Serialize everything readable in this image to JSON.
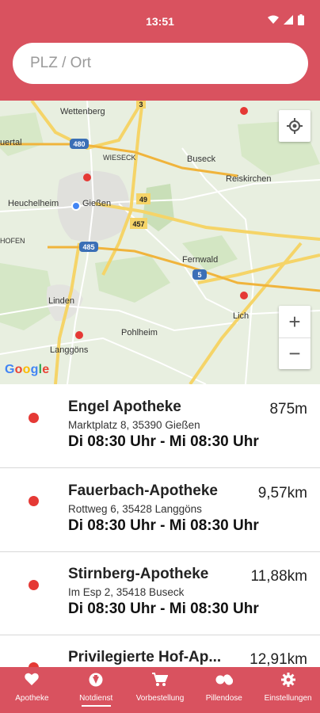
{
  "status_bar": {
    "time": "13:51",
    "icons": [
      "wifi-icon",
      "signal-icon",
      "battery-icon"
    ]
  },
  "search": {
    "placeholder": "PLZ / Ort",
    "value": ""
  },
  "map": {
    "place_labels": [
      "Wettenberg",
      "Wieseck",
      "Buseck",
      "Reiskirchen",
      "Heuchelheim",
      "Gießen",
      "Fernwald",
      "Linden",
      "Lich",
      "Pohlheim",
      "Langgöns",
      "uertal",
      "HOFEN"
    ],
    "road_numbers": [
      "3",
      "480",
      "49",
      "457",
      "485",
      "5"
    ],
    "google_logo": "Google",
    "zoom_in_label": "+",
    "zoom_out_label": "−",
    "marker_color": "#e53935",
    "location_dot_color": "#4285f4"
  },
  "pharmacies": [
    {
      "name": "Engel Apotheke",
      "address": "Marktplatz 8, 35390 Gießen",
      "hours": "Di 08:30 Uhr - Mi 08:30 Uhr",
      "distance": "875m"
    },
    {
      "name": "Fauerbach-Apotheke",
      "address": "Rottweg 6, 35428 Langgöns",
      "hours": "Di 08:30 Uhr - Mi 08:30 Uhr",
      "distance": "9,57km"
    },
    {
      "name": "Stirnberg-Apotheke",
      "address": "Im Esp 2, 35418 Buseck",
      "hours": "Di 08:30 Uhr - Mi 08:30 Uhr",
      "distance": "11,88km"
    },
    {
      "name": "Privilegierte Hof-Ap...",
      "distance": "12,91km"
    }
  ],
  "bottom_nav": [
    {
      "label": "Apotheke",
      "icon": "heart-icon",
      "active": false
    },
    {
      "label": "Notdienst",
      "icon": "emergency-icon",
      "active": true
    },
    {
      "label": "Vorbestellung",
      "icon": "cart-icon",
      "active": false
    },
    {
      "label": "Pillendose",
      "icon": "pill-icon",
      "active": false
    },
    {
      "label": "Einstellungen",
      "icon": "gear-icon",
      "active": false
    }
  ],
  "colors": {
    "brand": "#d9525f",
    "map_background": "#e8efe0",
    "road_yellow": "#f5d468",
    "marker": "#e53935"
  }
}
